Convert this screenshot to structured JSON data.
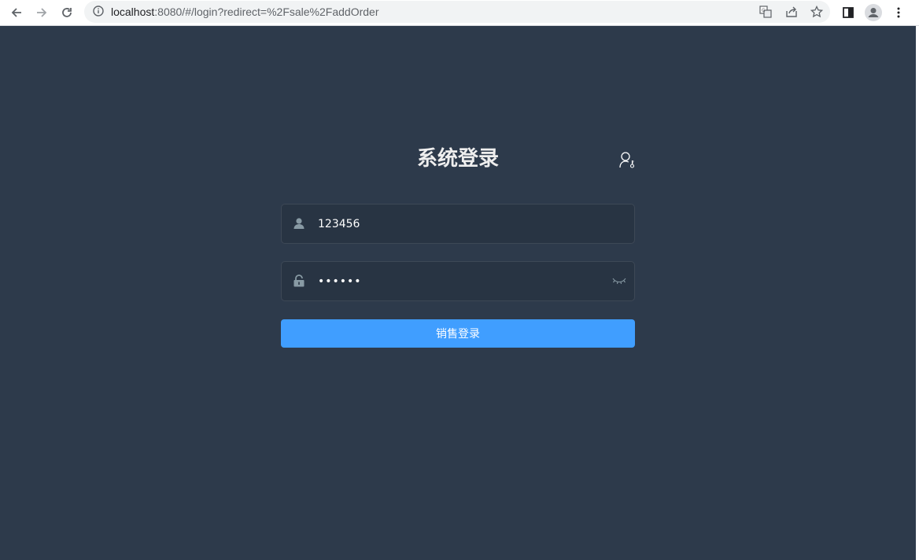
{
  "browser": {
    "url_host": "localhost",
    "url_rest": ":8080/#/login?redirect=%2Fsale%2FaddOrder"
  },
  "login": {
    "title": "系统登录",
    "username_value": "123456",
    "password_value": "••••••",
    "submit_label": "销售登录"
  },
  "icons": {
    "back": "arrow-left-icon",
    "forward": "arrow-right-icon",
    "reload": "reload-icon",
    "info": "info-icon",
    "translate": "translate-icon",
    "share": "share-icon",
    "bookmark": "star-icon",
    "sidepanel": "side-panel-icon",
    "profile": "profile-icon",
    "menu": "kebab-menu-icon",
    "user": "user-icon",
    "lock": "lock-icon",
    "eye": "eye-closed-icon",
    "switch": "user-key-icon"
  },
  "colors": {
    "background": "#2d3a4b",
    "input_bg": "#283443",
    "button": "#409eff",
    "title": "#eeeeee"
  }
}
